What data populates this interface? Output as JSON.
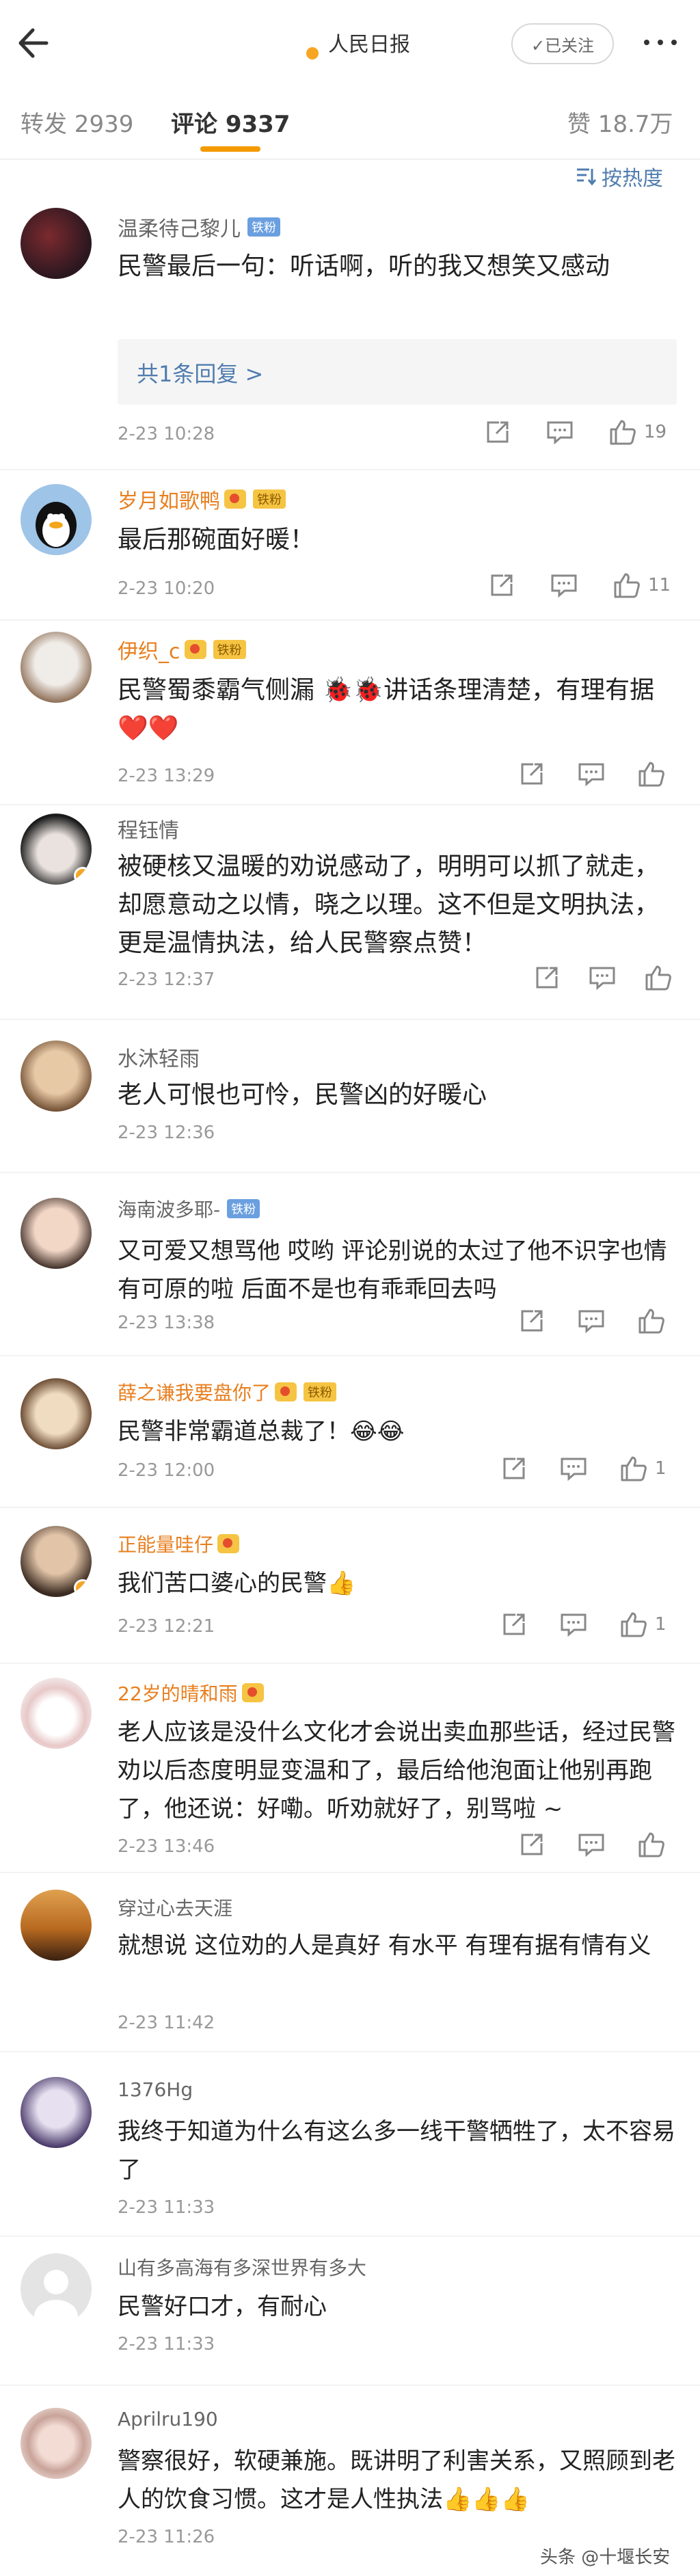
{
  "header": {
    "account_name": "人民日报",
    "logo_text": "人民日报",
    "follow_label": "✓已关注"
  },
  "tabs": {
    "repost": "转发 2939",
    "comment": "评论 9337",
    "like": "赞 18.7万"
  },
  "sort_label": "按热度",
  "comments": [
    {
      "user": "温柔待己黎儿",
      "badge": "铁粉",
      "text": "民警最后一句：听话啊，听的我又想笑又感动",
      "reply": "共1条回复 >",
      "time": "2-23 10:28",
      "likes": "19"
    },
    {
      "user": "岁月如歌鸭",
      "badge": "铁粉",
      "text": "最后那碗面好暖！",
      "time": "2-23 10:20",
      "likes": "11"
    },
    {
      "user": "伊织_c",
      "badge": "铁粉",
      "text": "民警蜀黍霸气侧漏 🐞🐞讲话条理清楚，有理有据 ❤️❤️",
      "time": "2-23 13:29",
      "likes": ""
    },
    {
      "user": "程钰情",
      "text": "被硬核又温暖的劝说感动了，明明可以抓了就走，却愿意动之以情，晓之以理。这不但是文明执法，更是温情执法，给人民警察点赞！",
      "time": "2-23 12:37",
      "likes": ""
    },
    {
      "user": "水沐轻雨",
      "text": "老人可恨也可怜，民警凶的好暖心",
      "time": "2-23 12:36"
    },
    {
      "user": "海南波多耶-",
      "badge": "铁粉",
      "text": "又可爱又想骂他 哎哟 评论别说的太过了他不识字也情有可原的啦 后面不是也有乖乖回去吗",
      "time": "2-23 13:38",
      "likes": ""
    },
    {
      "user": "薛之谦我要盘你了",
      "badge": "铁粉",
      "text": "民警非常霸道总裁了！😂😂",
      "time": "2-23 12:00",
      "likes": "1"
    },
    {
      "user": "正能量哇仔",
      "text": "我们苦口婆心的民警👍",
      "time": "2-23 12:21",
      "likes": "1"
    },
    {
      "user": "22岁的晴和雨",
      "text": "老人应该是没什么文化才会说出卖血那些话，经过民警劝以后态度明显变温和了，最后给他泡面让他别再跑了，他还说：好嘞。听劝就好了，别骂啦 ~",
      "time": "2-23 13:46",
      "likes": ""
    },
    {
      "user": "穿过心去天涯",
      "text": "就想说 这位劝的人是真好 有水平 有理有据有情有义",
      "time": "2-23 11:42"
    },
    {
      "user": "1376Hg",
      "text": "我终于知道为什么有这么多一线干警牺牲了，太不容易了",
      "time": "2-23 11:33"
    },
    {
      "user": "山有多高海有多深世界有多大",
      "text": "民警好口才，有耐心",
      "time": "2-23 11:33"
    },
    {
      "user": "Aprilru190",
      "text": "警察很好，软硬兼施。既讲明了利害关系，又照顾到老人的饮食习惯。这才是人性执法👍👍👍",
      "time": "2-23 11:26"
    }
  ],
  "watermark": "头条 @十堰长安",
  "colors": {
    "accent": "#f39a00",
    "link": "#507daf",
    "orange_name": "#e87f1f"
  }
}
